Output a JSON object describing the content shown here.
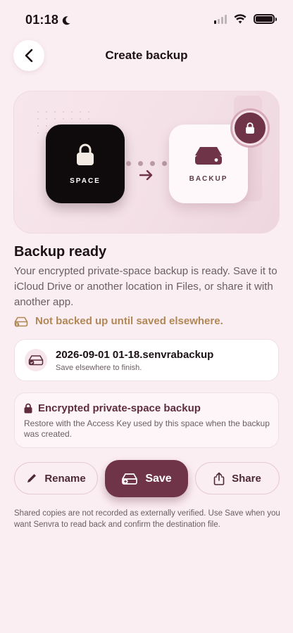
{
  "status_bar": {
    "time": "01:18"
  },
  "nav": {
    "title": "Create backup"
  },
  "hero": {
    "space_label": "SPACE",
    "backup_label": "BACKUP"
  },
  "content": {
    "heading": "Backup ready",
    "description": "Your encrypted private-space backup is ready. Save it to iCloud Drive or another location in Files, or share it with another app.",
    "warning": "Not backed up until saved elsewhere."
  },
  "file": {
    "name": "2026-09-01 01-18.senvrabackup",
    "subtitle": "Save elsewhere to finish."
  },
  "encrypted": {
    "title": "Encrypted private-space backup",
    "subtitle": "Restore with the Access Key used by this space when the backup was created."
  },
  "actions": {
    "rename": "Rename",
    "save": "Save",
    "share": "Share"
  },
  "footer": "Shared copies are not recorded as externally verified. Use Save when you want Senvra to read back and confirm the destination file.",
  "colors": {
    "accent": "#6f3447",
    "warning": "#b08755",
    "background": "#fbeef2"
  },
  "icons": [
    "moon-icon",
    "signal-icon",
    "wifi-icon",
    "battery-icon",
    "chevron-left-icon",
    "lock-icon",
    "drive-icon",
    "arrow-right-icon",
    "pencil-icon",
    "share-icon"
  ]
}
